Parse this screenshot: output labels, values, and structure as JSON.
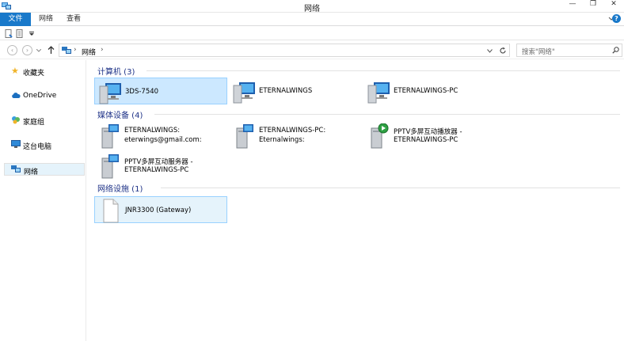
{
  "window": {
    "title": "网络",
    "minimize": "—",
    "restore": "❐",
    "close": "✕"
  },
  "ribbon": {
    "tabs": [
      "文件",
      "网络",
      "查看"
    ],
    "help": "?"
  },
  "address": {
    "path": "网络",
    "search_placeholder": "搜索\"网络\""
  },
  "nav": {
    "favorites": "收藏夹",
    "onedrive": "OneDrive",
    "homegroup": "家庭组",
    "thispc": "这台电脑",
    "network": "网络"
  },
  "groups": {
    "computers": "计算机 (3)",
    "media": "媒体设备 (4)",
    "infra": "网络设施 (1)"
  },
  "computers": [
    "3DS-7540",
    "ETERNALWINGS",
    "ETERNALWINGS-PC"
  ],
  "media": [
    {
      "line1": "ETERNALWINGS:",
      "line2": "eterwings@gmail.com:"
    },
    {
      "line1": "ETERNALWINGS-PC:",
      "line2": "Eternalwings:"
    },
    {
      "line1": "PPTV多屏互动播放器 -",
      "line2": "ETERNALWINGS-PC"
    },
    {
      "line1": "PPTV多屏互动服务器 -",
      "line2": "ETERNALWINGS-PC"
    }
  ],
  "infra": [
    "JNR3300 (Gateway)"
  ],
  "colors": {
    "accent": "#1979ca",
    "selection": "#cce8ff",
    "hover": "#e5f3fb",
    "group_header": "#1e3287"
  }
}
